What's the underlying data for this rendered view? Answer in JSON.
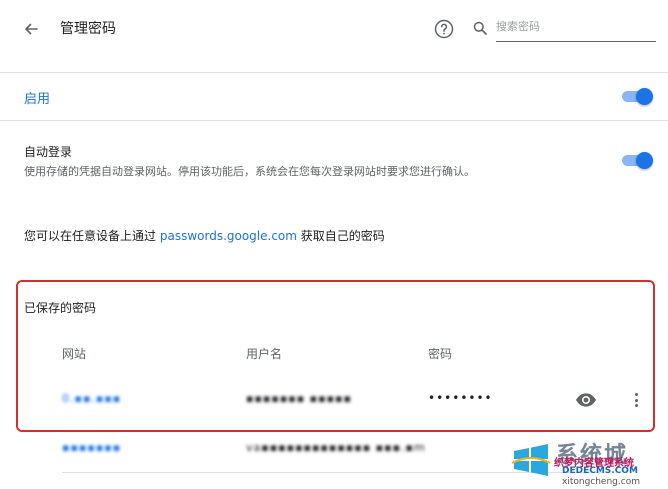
{
  "header": {
    "title": "管理密码",
    "search_placeholder": "搜索密码",
    "back_icon": "arrow-left",
    "help_icon": "question-circle",
    "search_icon": "magnifier"
  },
  "settings": {
    "enable": {
      "label": "启用",
      "enabled": true
    },
    "auto_login": {
      "title": "自动登录",
      "description": "使用存储的凭据自动登录网站。停用该功能后，系统会在您每次登录网站时要求您进行确认。",
      "enabled": true
    },
    "info": {
      "prefix": "您可以在任意设备上通过",
      "link": "passwords.google.com",
      "suffix": "获取自己的密码"
    }
  },
  "saved_passwords": {
    "heading": "已保存的密码",
    "columns": {
      "site": "网站",
      "username": "用户名",
      "password": "密码"
    },
    "rows": [
      {
        "site": "0.▪▪.▪▪▪",
        "username": "▪▪▪▪▪▪▪ ▪▪▪▪▪",
        "password": "••••••••"
      },
      {
        "site": "▪▪▪▪▪▪▪",
        "username": "va▪▪▪▪▪▪▪▪▪▪▪▪▪ ▪▪▪.▪m",
        "password": ""
      }
    ]
  },
  "watermark": {
    "brand_cn": "系统城",
    "sub_cn": "织梦内容管理系统",
    "site": "DEDECMS.COM",
    "pinyin": "xitongcheng.com"
  },
  "colors": {
    "accent": "#1a73e8",
    "toggle_track": "#8ab4f8",
    "highlight": "#d32f2f"
  }
}
